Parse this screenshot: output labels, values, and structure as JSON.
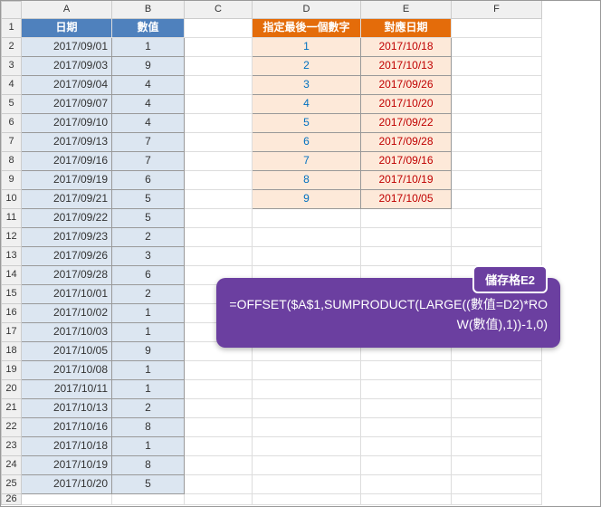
{
  "columns": [
    "",
    "A",
    "B",
    "C",
    "D",
    "E",
    "F"
  ],
  "headers": {
    "col_a": "日期",
    "col_b": "數值",
    "col_d": "指定最後一個數字",
    "col_e": "對應日期"
  },
  "left": [
    {
      "date": "2017/09/01",
      "val": "1"
    },
    {
      "date": "2017/09/03",
      "val": "9"
    },
    {
      "date": "2017/09/04",
      "val": "4"
    },
    {
      "date": "2017/09/07",
      "val": "4"
    },
    {
      "date": "2017/09/10",
      "val": "4"
    },
    {
      "date": "2017/09/13",
      "val": "7"
    },
    {
      "date": "2017/09/16",
      "val": "7"
    },
    {
      "date": "2017/09/19",
      "val": "6"
    },
    {
      "date": "2017/09/21",
      "val": "5"
    },
    {
      "date": "2017/09/22",
      "val": "5"
    },
    {
      "date": "2017/09/23",
      "val": "2"
    },
    {
      "date": "2017/09/26",
      "val": "3"
    },
    {
      "date": "2017/09/28",
      "val": "6"
    },
    {
      "date": "2017/10/01",
      "val": "2"
    },
    {
      "date": "2017/10/02",
      "val": "1"
    },
    {
      "date": "2017/10/03",
      "val": "1"
    },
    {
      "date": "2017/10/05",
      "val": "9"
    },
    {
      "date": "2017/10/08",
      "val": "1"
    },
    {
      "date": "2017/10/11",
      "val": "1"
    },
    {
      "date": "2017/10/13",
      "val": "2"
    },
    {
      "date": "2017/10/16",
      "val": "8"
    },
    {
      "date": "2017/10/18",
      "val": "1"
    },
    {
      "date": "2017/10/19",
      "val": "8"
    },
    {
      "date": "2017/10/20",
      "val": "5"
    }
  ],
  "right": [
    {
      "n": "1",
      "d": "2017/10/18"
    },
    {
      "n": "2",
      "d": "2017/10/13"
    },
    {
      "n": "3",
      "d": "2017/09/26"
    },
    {
      "n": "4",
      "d": "2017/10/20"
    },
    {
      "n": "5",
      "d": "2017/09/22"
    },
    {
      "n": "6",
      "d": "2017/09/28"
    },
    {
      "n": "7",
      "d": "2017/09/16"
    },
    {
      "n": "8",
      "d": "2017/10/19"
    },
    {
      "n": "9",
      "d": "2017/10/05"
    }
  ],
  "callout": {
    "tag": "儲存格E2",
    "formula": "=OFFSET($A$1,SUMPRODUCT(LARGE((數值=D2)*ROW(數值),1))-1,0)"
  },
  "last_row": 26
}
